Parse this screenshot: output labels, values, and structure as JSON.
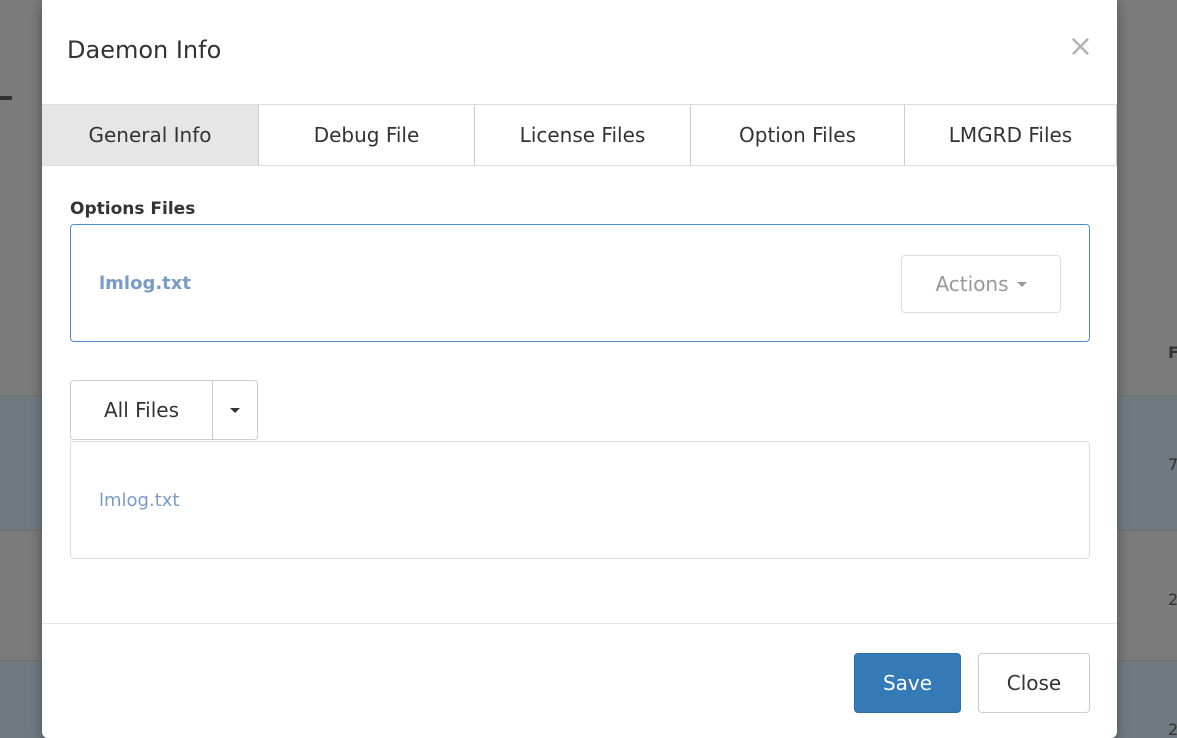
{
  "modal": {
    "title": "Daemon Info",
    "close_glyph": "×"
  },
  "tabs": [
    {
      "label": "General Info",
      "active": true
    },
    {
      "label": "Debug File",
      "active": false
    },
    {
      "label": "License Files",
      "active": false
    },
    {
      "label": "Option Files",
      "active": false
    },
    {
      "label": "LMGRD Files",
      "active": false
    }
  ],
  "options_section": {
    "label": "Options Files",
    "file": "lmlog.txt",
    "actions_label": "Actions"
  },
  "files_filter": {
    "selected": "All Files"
  },
  "files_list": {
    "items": [
      "lmlog.txt"
    ]
  },
  "footer": {
    "save_label": "Save",
    "close_label": "Close"
  },
  "background": {
    "header_fragment": "F",
    "row_fragments": [
      "7",
      "2",
      "2"
    ]
  },
  "colors": {
    "primary": "#337ab7",
    "link": "#7a9bc9",
    "focus_border": "#4a8fcf",
    "overlay": "#7b7b7b"
  },
  "icons": {
    "close": "close-icon",
    "dropdown": "caret-down-icon"
  }
}
